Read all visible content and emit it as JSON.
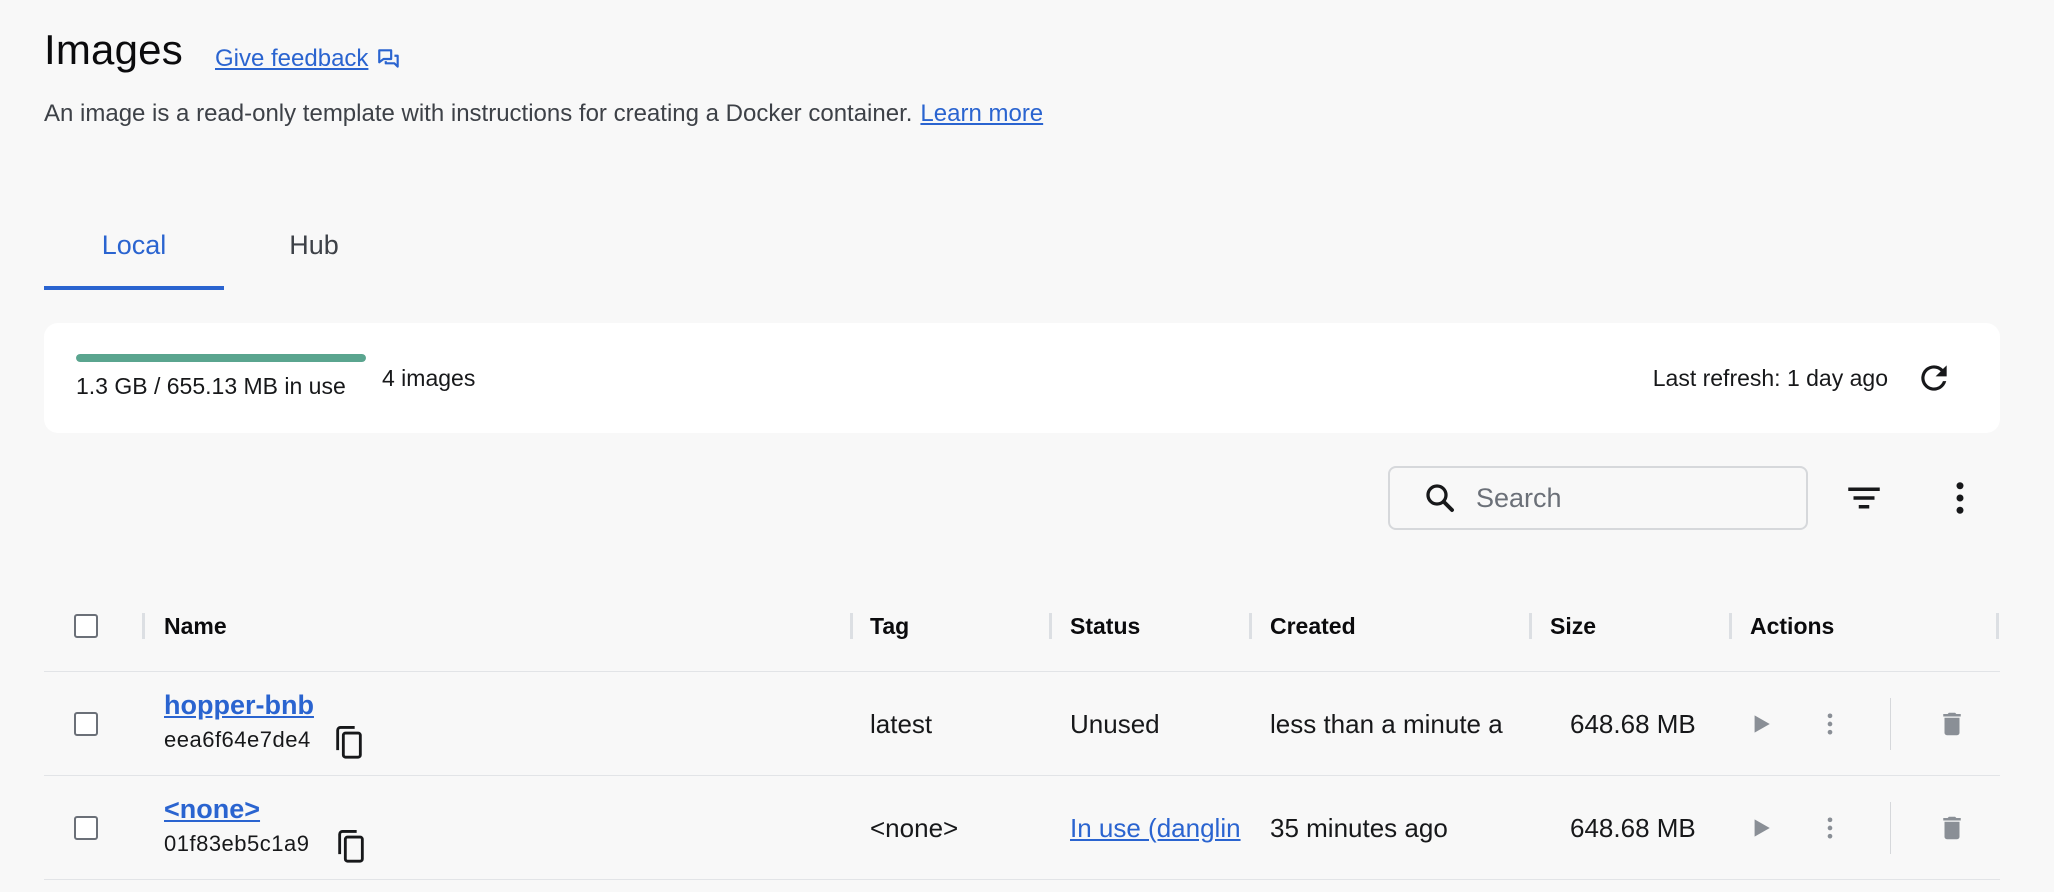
{
  "header": {
    "title": "Images",
    "feedback_label": "Give feedback",
    "feedback_icon": "feedback-icon",
    "description": "An image is a read-only template with instructions for creating a Docker container.",
    "learn_more_label": "Learn more"
  },
  "tabs": [
    {
      "label": "Local",
      "active": true
    },
    {
      "label": "Hub",
      "active": false
    }
  ],
  "storage": {
    "usage_text": "1.3 GB / 655.13 MB in use",
    "usage_fraction": 1.0,
    "bar_color": "#5aa58f",
    "image_count": "4 images",
    "last_refresh": "Last refresh: 1 day ago",
    "refresh_icon": "refresh-icon"
  },
  "toolbar": {
    "search_placeholder": "Search",
    "search_value": "",
    "filter_icon": "filter-icon",
    "more_icon": "more-vert-icon"
  },
  "table": {
    "columns": [
      "Name",
      "Tag",
      "Status",
      "Created",
      "Size",
      "Actions"
    ],
    "rows": [
      {
        "name": "hopper-bnb",
        "id": "eea6f64e7de4",
        "tag": "latest",
        "status": "Unused",
        "status_is_link": false,
        "created": "less than a minute a",
        "size": "648.68 MB"
      },
      {
        "name": "<none>",
        "id": "01f83eb5c1a9",
        "tag": "<none>",
        "status": "In use (danglin",
        "status_is_link": true,
        "created": "35 minutes ago",
        "size": "648.68 MB"
      }
    ]
  },
  "colors": {
    "accent": "#2a64d0",
    "background": "#f8f8f8",
    "panel": "#ffffff"
  }
}
